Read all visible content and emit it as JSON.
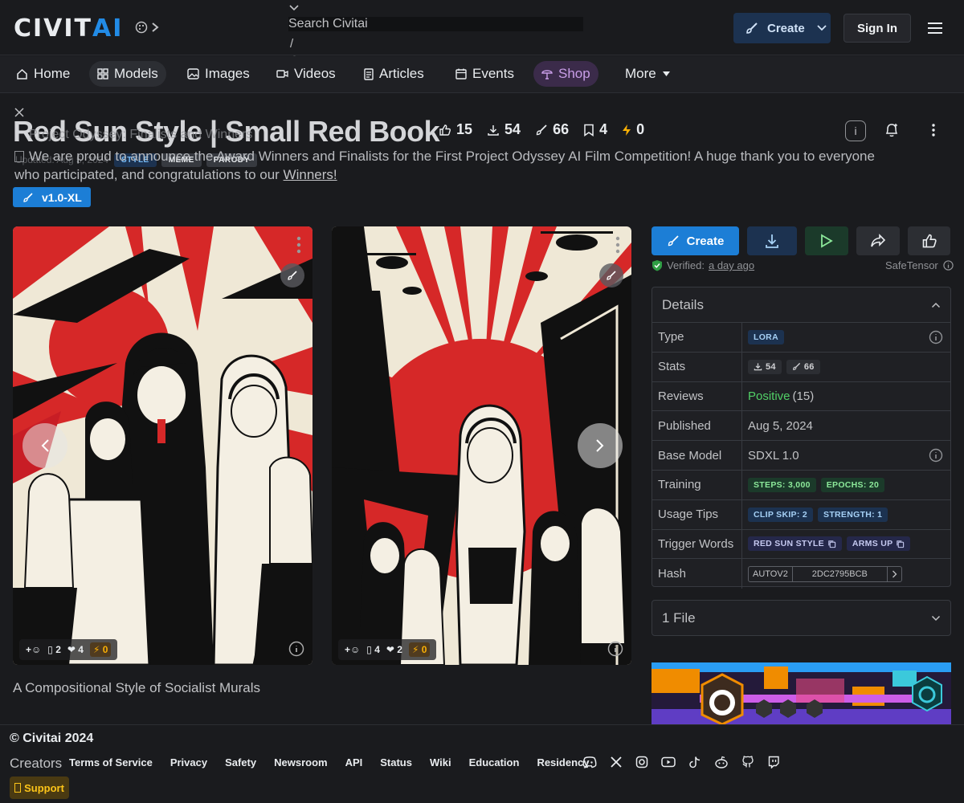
{
  "header": {
    "logo_left": "CIVIT",
    "logo_right": "AI",
    "search_placeholder": "Search Civitai",
    "search_shortcut": "/",
    "create_label": "Create",
    "signin_label": "Sign In"
  },
  "nav": {
    "items": [
      {
        "label": "Home",
        "icon": "home-icon"
      },
      {
        "label": "Models",
        "icon": "grid-icon"
      },
      {
        "label": "Images",
        "icon": "photo-icon"
      },
      {
        "label": "Videos",
        "icon": "video-icon"
      },
      {
        "label": "Articles",
        "icon": "article-icon"
      },
      {
        "label": "Events",
        "icon": "calendar-icon"
      },
      {
        "label": "Shop",
        "icon": "shop-icon"
      },
      {
        "label": "More",
        "icon": "caret-down-icon"
      }
    ]
  },
  "model": {
    "title": "Red Sun Style | Small Red Book",
    "stats": {
      "likes": "15",
      "downloads": "54",
      "links": "66",
      "bookmarks": "4",
      "buzz": "0"
    },
    "updated": "Updated: Aug 5, 2024",
    "tags": [
      "STYLE",
      "MEME",
      "PARODY"
    ],
    "version": "v1.0-XL",
    "description": "A Compositional Style of Socialist Murals"
  },
  "announcement": {
    "heading": "Project Odyssey: Finalists and Winners",
    "body_text": "We are proud to announce the Award Winners and Finalists for the First Project Odyssey AI Film Competition! A huge thank you to everyone who participated, and congratulations to our ",
    "link_text": "Winners!"
  },
  "gallery": [
    {
      "comments": "2",
      "hearts": "4",
      "buzz": "0"
    },
    {
      "comments": "4",
      "hearts": "2",
      "buzz": "0"
    }
  ],
  "actions": {
    "create_label": "Create",
    "verified_label": "Verified:",
    "verified_time": "a day ago",
    "format_label": "SafeTensor"
  },
  "details": {
    "title": "Details",
    "rows": {
      "type_label": "Type",
      "type_value": "LORA",
      "stats_label": "Stats",
      "stats_downloads": "54",
      "stats_links": "66",
      "reviews_label": "Reviews",
      "reviews_value": "Positive",
      "reviews_count": "(15)",
      "published_label": "Published",
      "published_value": "Aug 5, 2024",
      "base_label": "Base Model",
      "base_value": "SDXL 1.0",
      "training_label": "Training",
      "training_steps": "STEPS: 3,000",
      "training_epochs": "EPOCHS: 20",
      "usage_label": "Usage Tips",
      "usage_clip": "CLIP SKIP: 2",
      "usage_strength": "STRENGTH: 1",
      "trigger_label": "Trigger Words",
      "trigger_1": "RED SUN STYLE",
      "trigger_2": "ARMS UP",
      "hash_label": "Hash",
      "hash_type": "AUTOV2",
      "hash_value": "2DC2795BCB"
    }
  },
  "files": {
    "label": "1 File"
  },
  "footer": {
    "copyright": "© Civitai 2024",
    "creators": "Creators",
    "links": [
      "Terms of Service",
      "Privacy",
      "Safety",
      "Newsroom",
      "API",
      "Status",
      "Wiki",
      "Education",
      "Residency"
    ],
    "support": "Support",
    "social_icons": [
      "discord-icon",
      "x-icon",
      "instagram-icon",
      "youtube-icon",
      "tiktok-icon",
      "reddit-icon",
      "github-icon",
      "twitch-icon"
    ]
  },
  "colors": {
    "accent": "#1c7ed6",
    "background": "#1a1b1e",
    "positive": "#51cf66",
    "buzz": "#fab005"
  }
}
